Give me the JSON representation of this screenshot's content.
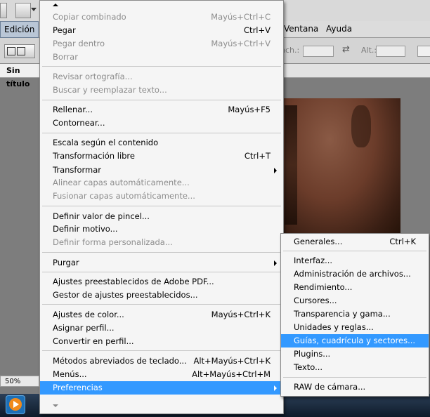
{
  "menubar": {
    "items": [
      {
        "label": "Edición",
        "state": "active"
      },
      {
        "label": "Ventana"
      },
      {
        "label": "Ayuda"
      }
    ]
  },
  "optionsbar": {
    "width_label": "nch.:",
    "height_label": "Alt.:"
  },
  "document": {
    "tab_title": "Sin título",
    "zoom": "50%"
  },
  "edit_menu": {
    "items": [
      {
        "label": "Copiar combinado",
        "shortcut": "Mayús+Ctrl+C",
        "disabled": true
      },
      {
        "label": "Pegar",
        "shortcut": "Ctrl+V",
        "disabled": false
      },
      {
        "label": "Pegar dentro",
        "shortcut": "Mayús+Ctrl+V",
        "disabled": true
      },
      {
        "label": "Borrar",
        "shortcut": "",
        "disabled": true
      },
      {
        "label": "Revisar ortografía...",
        "shortcut": "",
        "disabled": true
      },
      {
        "label": "Buscar y reemplazar texto...",
        "shortcut": "",
        "disabled": true
      },
      {
        "label": "Rellenar...",
        "shortcut": "Mayús+F5",
        "disabled": false
      },
      {
        "label": "Contornear...",
        "shortcut": "",
        "disabled": false
      },
      {
        "label": "Escala según el contenido",
        "shortcut": "",
        "disabled": false
      },
      {
        "label": "Transformación libre",
        "shortcut": "Ctrl+T",
        "disabled": false
      },
      {
        "label": "Transformar",
        "shortcut": "",
        "disabled": false,
        "submenu": true
      },
      {
        "label": "Alinear capas automáticamente...",
        "shortcut": "",
        "disabled": true
      },
      {
        "label": "Fusionar capas automáticamente...",
        "shortcut": "",
        "disabled": true
      },
      {
        "label": "Definir valor de pincel...",
        "shortcut": "",
        "disabled": false
      },
      {
        "label": "Definir motivo...",
        "shortcut": "",
        "disabled": false
      },
      {
        "label": "Definir forma personalizada...",
        "shortcut": "",
        "disabled": true
      },
      {
        "label": "Purgar",
        "shortcut": "",
        "disabled": false,
        "submenu": true
      },
      {
        "label": "Ajustes preestablecidos de Adobe PDF...",
        "shortcut": "",
        "disabled": false
      },
      {
        "label": "Gestor de ajustes preestablecidos...",
        "shortcut": "",
        "disabled": false
      },
      {
        "label": "Ajustes de color...",
        "shortcut": "Mayús+Ctrl+K",
        "disabled": false
      },
      {
        "label": "Asignar perfil...",
        "shortcut": "",
        "disabled": false
      },
      {
        "label": "Convertir en perfil...",
        "shortcut": "",
        "disabled": false
      },
      {
        "label": "Métodos abreviados de teclado...",
        "shortcut": "Alt+Mayús+Ctrl+K",
        "disabled": false
      },
      {
        "label": "Menús...",
        "shortcut": "Alt+Mayús+Ctrl+M",
        "disabled": false
      },
      {
        "label": "Preferencias",
        "shortcut": "",
        "disabled": false,
        "submenu": true,
        "selected": true
      }
    ]
  },
  "prefs_submenu": {
    "items": [
      {
        "label": "Generales...",
        "shortcut": "Ctrl+K"
      },
      {
        "label": "Interfaz...",
        "shortcut": ""
      },
      {
        "label": "Administración de archivos...",
        "shortcut": ""
      },
      {
        "label": "Rendimiento...",
        "shortcut": ""
      },
      {
        "label": "Cursores...",
        "shortcut": ""
      },
      {
        "label": "Transparencia y gama...",
        "shortcut": ""
      },
      {
        "label": "Unidades y reglas...",
        "shortcut": ""
      },
      {
        "label": "Guías, cuadrícula y sectores...",
        "shortcut": "",
        "selected": true
      },
      {
        "label": "Plugins...",
        "shortcut": ""
      },
      {
        "label": "Texto...",
        "shortcut": ""
      },
      {
        "label": "RAW de cámara...",
        "shortcut": ""
      }
    ]
  },
  "colors": {
    "highlight": "#3399ff",
    "disabled_text": "#8c8c8c"
  }
}
